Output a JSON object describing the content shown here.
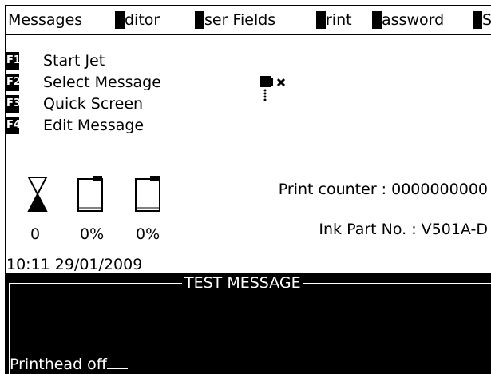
{
  "menu": {
    "items": [
      {
        "lead": "M",
        "label": "essages"
      },
      {
        "lead": "E",
        "label": "ditor"
      },
      {
        "lead": "U",
        "label": "ser Fields"
      },
      {
        "lead": "P",
        "label": "rint"
      },
      {
        "lead": "P",
        "label": "assword"
      },
      {
        "lead": "S",
        "label": ""
      }
    ]
  },
  "function_keys": [
    {
      "key": "F1",
      "label": "Start Jet"
    },
    {
      "key": "F2",
      "label": "Select Message"
    },
    {
      "key": "F3",
      "label": "Quick Screen"
    },
    {
      "key": "F4",
      "label": "Edit Message"
    }
  ],
  "jet_status_icon": "printhead-jet-off-icon",
  "gauges": {
    "hourglass_value": "0",
    "ink_level": "0%",
    "makeup_level": "0%"
  },
  "info": {
    "print_counter": "Print counter : 0000000000",
    "ink_part": "Ink Part No. : V501A-D"
  },
  "datetime": "10:11 29/01/2009",
  "message": {
    "title": "TEST MESSAGE",
    "status": "Printhead off"
  }
}
